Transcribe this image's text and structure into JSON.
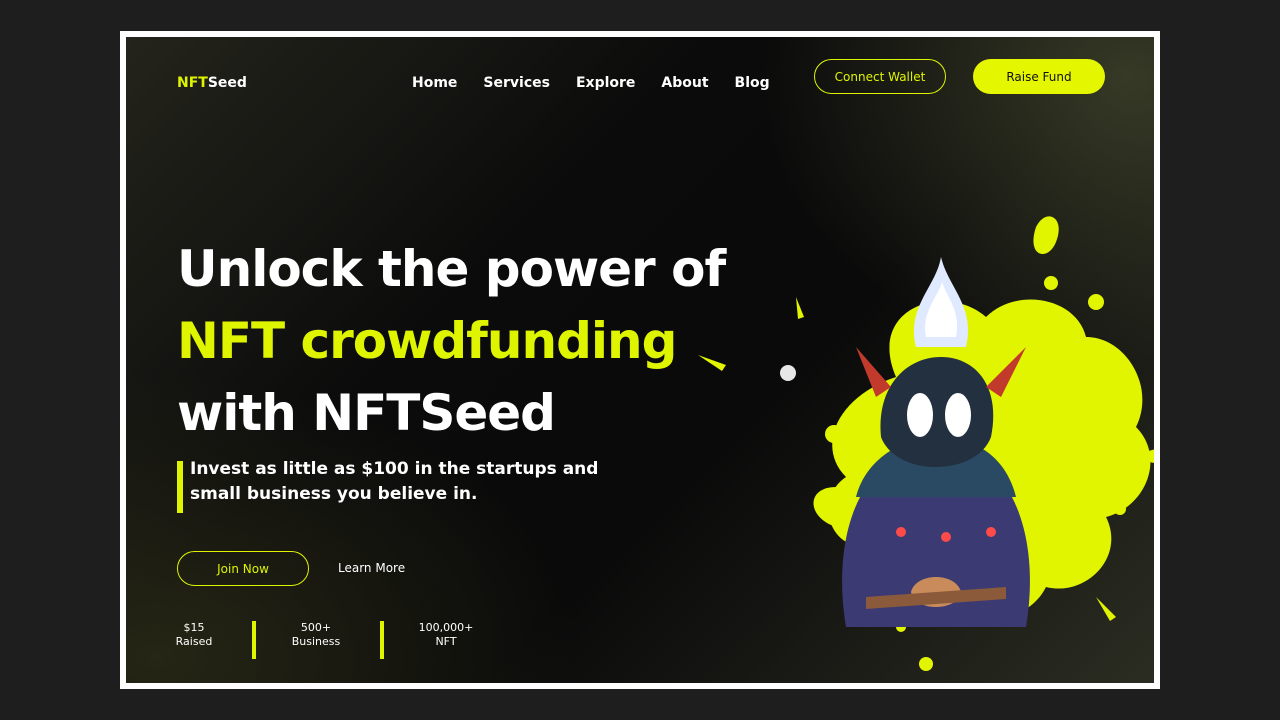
{
  "brand": {
    "prefix": "NFT",
    "suffix": "Seed"
  },
  "nav": {
    "home": "Home",
    "services": "Services",
    "explore": "Explore",
    "about": "About",
    "blog": "Blog"
  },
  "header": {
    "connect_wallet": "Connect Wallet",
    "raise_fund": "Raise Fund"
  },
  "hero": {
    "line1": "Unlock the power of",
    "line2": "NFT crowdfunding",
    "line3": "with NFTSeed",
    "tagline": "Invest as little as $100 in the startups and small business you believe in.",
    "join_now": "Join Now",
    "learn_more": "Learn More"
  },
  "stats": [
    {
      "value": "$15",
      "label": "Raised"
    },
    {
      "value": "500+",
      "label": "Business"
    },
    {
      "value": "100,000+",
      "label": "NFT"
    }
  ],
  "colors": {
    "accent": "#dff500",
    "background": "#0b0b0b",
    "frame": "#ffffff",
    "outer": "#1e1e1e"
  },
  "illustration": {
    "icon": "nft-character-with-paint-splash"
  }
}
